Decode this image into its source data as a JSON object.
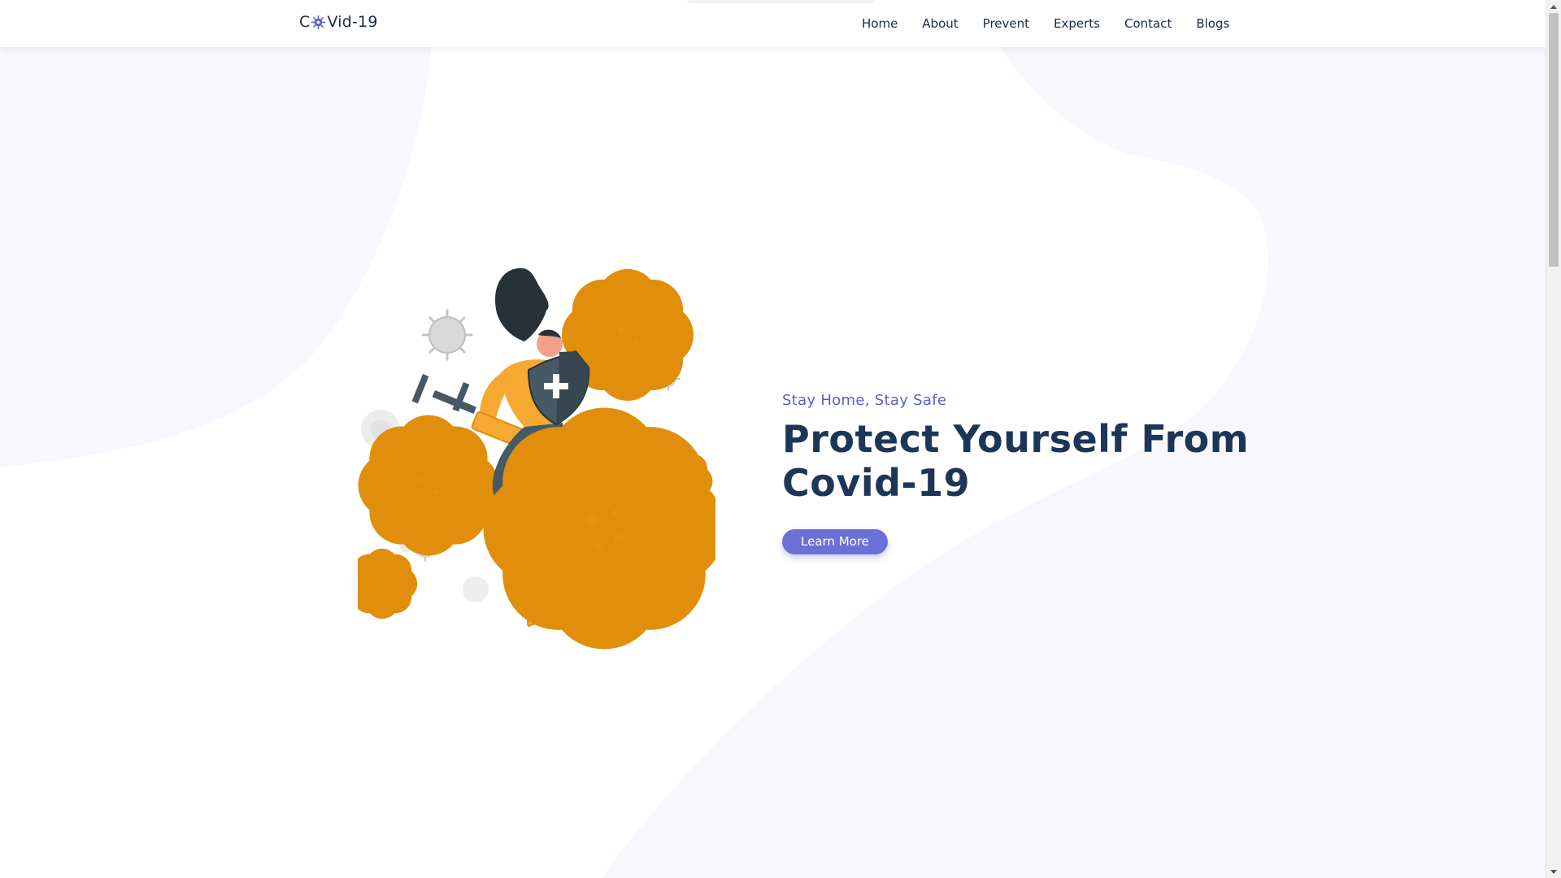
{
  "brand": {
    "prefix": "C",
    "suffix": "Vid-19",
    "icon": "virus-icon"
  },
  "nav": {
    "items": [
      {
        "label": "Home"
      },
      {
        "label": "About"
      },
      {
        "label": "Prevent"
      },
      {
        "label": "Experts"
      },
      {
        "label": "Contact"
      },
      {
        "label": "Blogs"
      }
    ]
  },
  "hero": {
    "tagline": "Stay Home, Stay Safe",
    "title_line1": "Protect Yourself From",
    "title_line2": "Covid-19",
    "cta_label": "Learn More",
    "illustration": "woman-with-shield-and-syringe-fighting-viruses"
  },
  "colors": {
    "accent": "#6c6fd6",
    "heading": "#1d3557",
    "tagline": "#5b5fc7",
    "virus": "#f5a623",
    "background_blob": "#f7f7fd"
  }
}
